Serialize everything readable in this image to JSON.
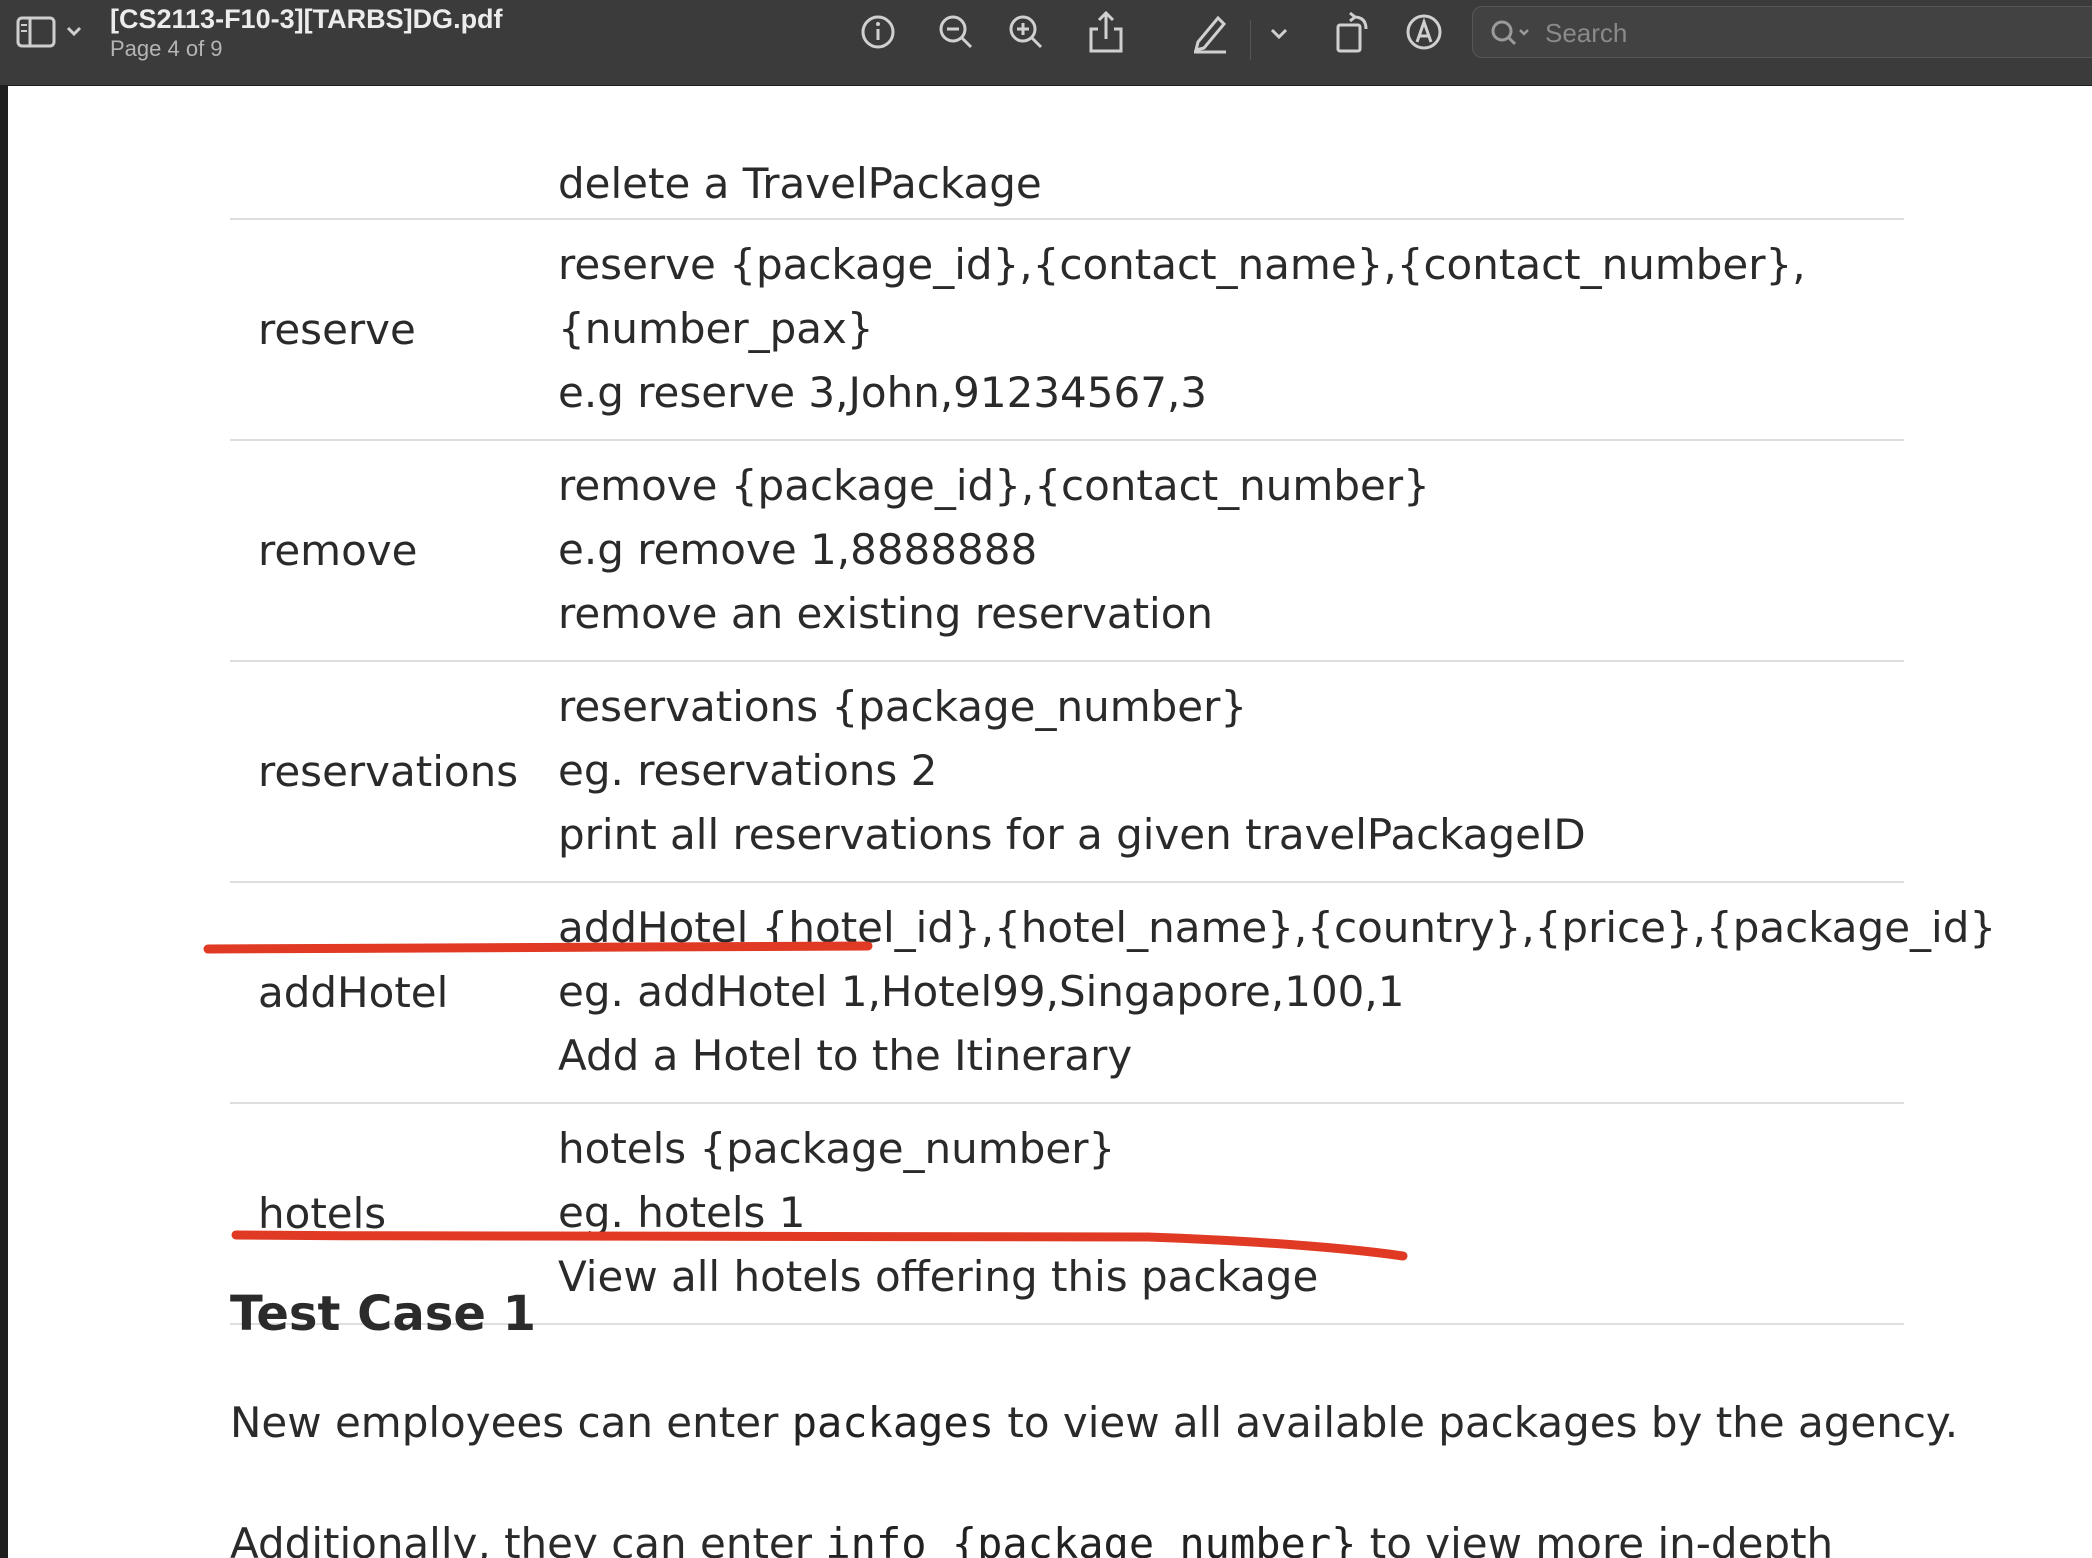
{
  "toolbar": {
    "title": "[CS2113-F10-3][TARBS]DG.pdf",
    "page_indicator": "Page 4 of 9",
    "search_placeholder": "Search",
    "icons": [
      "sidebar-icon",
      "chevron-down-icon",
      "info-icon",
      "zoom-out-icon",
      "zoom-in-icon",
      "share-icon",
      "markup-pen-icon",
      "chevron-down-icon",
      "rotate-icon",
      "markup-circle-icon",
      "search-icon"
    ]
  },
  "table": {
    "rows": [
      {
        "command": "",
        "lines": [
          "delete a TravelPackage"
        ]
      },
      {
        "command": "reserve",
        "lines": [
          "reserve {package_id},{contact_name},{contact_number},",
          "{number_pax}",
          "e.g reserve 3,John,91234567,3"
        ]
      },
      {
        "command": "remove",
        "lines": [
          "remove {package_id},{contact_number}",
          "e.g remove 1,8888888",
          "remove an existing reservation"
        ]
      },
      {
        "command": "reservations",
        "lines": [
          "reservations {package_number}",
          "eg. reservations 2",
          "print all reservations for a given travelPackageID"
        ]
      },
      {
        "command": "addHotel",
        "lines": [
          "addHotel {hotel_id},{hotel_name},{country},{price},{package_id}",
          "eg. addHotel 1,Hotel99,Singapore,100,1",
          "Add a Hotel to the Itinerary"
        ]
      },
      {
        "command": "hotels",
        "lines": [
          "hotels {package_number}",
          "eg. hotels 1",
          "View all hotels offering this package"
        ]
      }
    ]
  },
  "section": {
    "heading": "Test Case 1",
    "para1_before": "New employees can enter ",
    "para1_code": "packages",
    "para1_after": " to view all available packages by the agency.",
    "para2_before": "Additionally, they can enter ",
    "para2_code": "info {package_number}",
    "para2_after": " to view more in-depth"
  },
  "annotation_color": "#e03a24"
}
